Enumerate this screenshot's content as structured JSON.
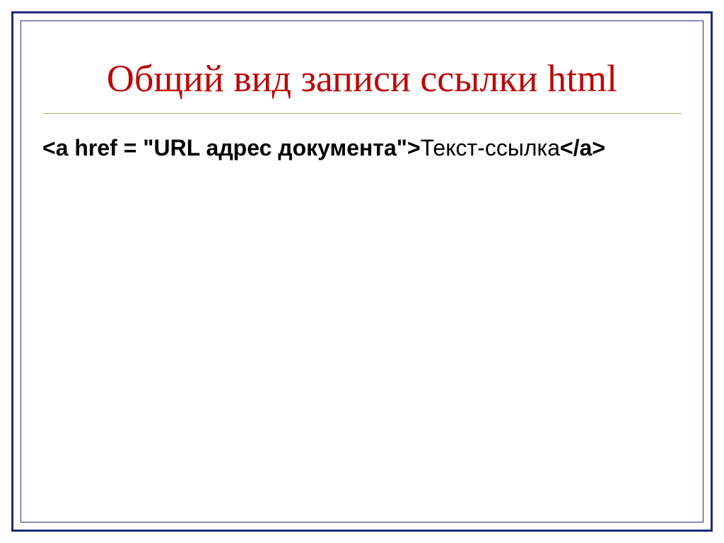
{
  "slide": {
    "title": "Общий вид записи ссылки html",
    "code": {
      "open_bold": "<a href = \"URL адрес документа\">",
      "middle_normal": "Текст-ссылка",
      "close_bold": "</a>"
    }
  }
}
